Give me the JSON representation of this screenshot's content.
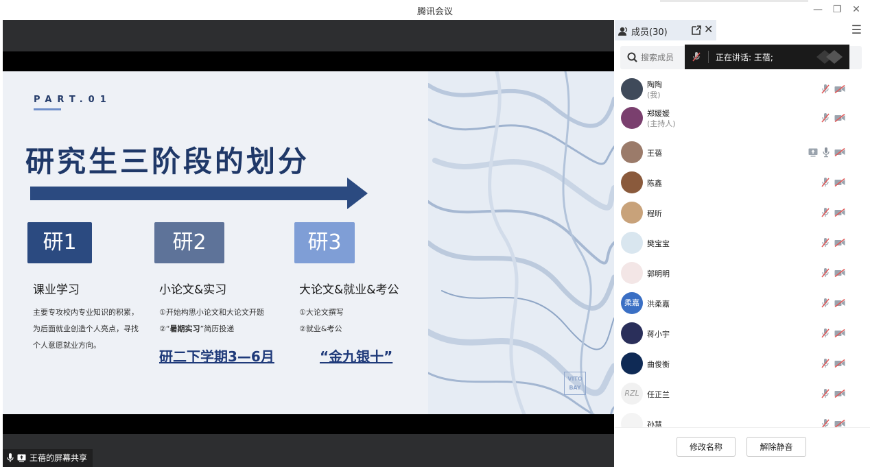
{
  "app": {
    "title": "腾讯会议",
    "window_controls": {
      "minimize": "—",
      "restore": "❐",
      "close": "✕"
    }
  },
  "slide": {
    "part_label": "PART.01",
    "headline": "研究生三阶段的划分",
    "stages": [
      {
        "box": "研1",
        "box_color": "#2b4a80",
        "title": "课业学习",
        "desc": [
          "主要专攻校内专业知识的积累，",
          "为后面就业创造个人亮点，寻找",
          "个人意愿就业方向。"
        ],
        "link": ""
      },
      {
        "box": "研2",
        "box_color": "#5e7399",
        "title": "小论文&实习",
        "desc_1": "①开始构思小论文和大论文开题",
        "desc_2_pre": "②“",
        "desc_2_bold": "暑期实习",
        "desc_2_post": "”简历投递",
        "link": "研二下学期3—6月"
      },
      {
        "box": "研3",
        "box_color": "#7f9ed6",
        "title": "大论文&就业&考公",
        "desc": [
          "①大论文撰写",
          "②就业&考公"
        ],
        "link": "“金九银十”"
      }
    ],
    "watermark": {
      "line1": "VITO",
      "line2": "BAY"
    }
  },
  "share_label": "王蓓的屏幕共享",
  "panel": {
    "tab_label": "成员(30)",
    "search_placeholder": "搜索成员",
    "speaking_text": "正在讲话:  王蓓;",
    "members": [
      {
        "name": "陶陶",
        "role": "(我)",
        "avatar_color": "#3f4a5a",
        "avatar_text": "",
        "sharing": false,
        "mic_on": false
      },
      {
        "name": "郑媛媛",
        "role": "(主持人)",
        "avatar_color": "#7a3f6e",
        "avatar_text": "",
        "sharing": false,
        "mic_on": false
      },
      {
        "name": "王蓓",
        "role": "",
        "avatar_color": "#9b7b6a",
        "avatar_text": "",
        "sharing": true,
        "mic_on": true
      },
      {
        "name": "陈鑫",
        "role": "",
        "avatar_color": "#8a5a3c",
        "avatar_text": "",
        "sharing": false,
        "mic_on": false
      },
      {
        "name": "程昕",
        "role": "",
        "avatar_color": "#c8a27a",
        "avatar_text": "",
        "sharing": false,
        "mic_on": false
      },
      {
        "name": "樊宝宝",
        "role": "",
        "avatar_color": "#d9e6ef",
        "avatar_text": "",
        "sharing": false,
        "mic_on": false
      },
      {
        "name": "郭明明",
        "role": "",
        "avatar_color": "#f3e6e6",
        "avatar_text": "",
        "sharing": false,
        "mic_on": false
      },
      {
        "name": "洪柔嘉",
        "role": "",
        "avatar_color": "#3a6fc4",
        "avatar_text": "柔嘉",
        "sharing": false,
        "mic_on": false
      },
      {
        "name": "蒋小宇",
        "role": "",
        "avatar_color": "#2a2f5a",
        "avatar_text": "",
        "sharing": false,
        "mic_on": false
      },
      {
        "name": "曲俊衡",
        "role": "",
        "avatar_color": "#0f2a55",
        "avatar_text": "",
        "sharing": false,
        "mic_on": false
      },
      {
        "name": "任正兰",
        "role": "",
        "avatar_color": "#f1f1f1",
        "avatar_text": "RZL",
        "sharing": false,
        "mic_on": false
      },
      {
        "name": "孙慧",
        "role": "",
        "avatar_color": "#f4f4f4",
        "avatar_text": "",
        "sharing": false,
        "mic_on": false
      }
    ],
    "buttons": {
      "rename": "修改名称",
      "unmute": "解除静音"
    }
  },
  "colors": {
    "accent": "#1f3868",
    "muted_icon": "#e05a5a"
  }
}
